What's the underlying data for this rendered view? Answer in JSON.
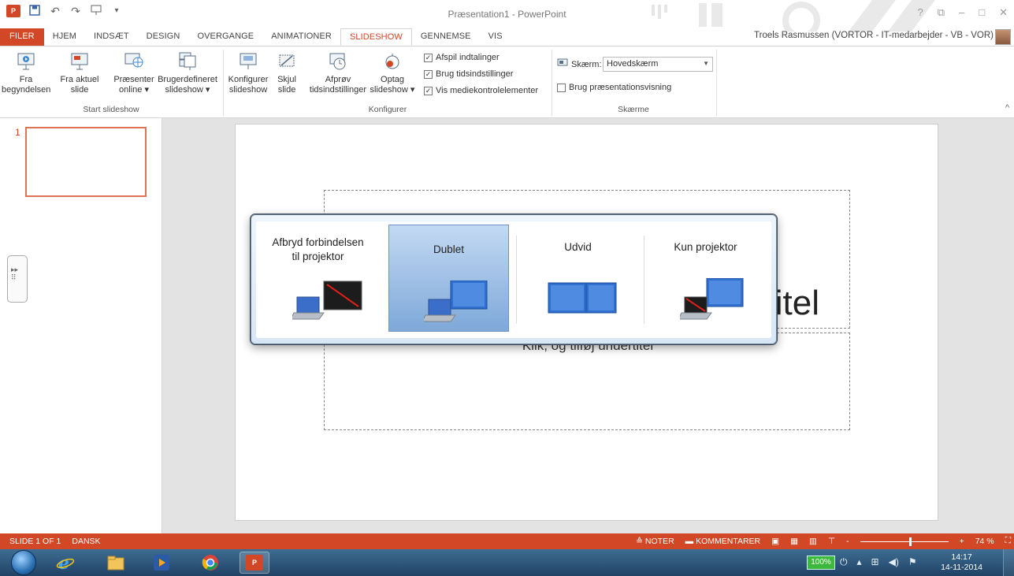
{
  "window": {
    "title": "Præsentation1 - PowerPoint",
    "app_badge": "P",
    "user": "Troels Rasmussen (VORTOR - IT-medarbejder - VB - VOR)",
    "help": "?",
    "restore_icon": "⧉",
    "minimize_icon": "–",
    "maximize_icon": "□",
    "close_icon": "✕"
  },
  "tabs": [
    {
      "label": "FILER"
    },
    {
      "label": "HJEM"
    },
    {
      "label": "INDSÆT"
    },
    {
      "label": "DESIGN"
    },
    {
      "label": "OVERGANGE"
    },
    {
      "label": "ANIMATIONER"
    },
    {
      "label": "SLIDESHOW"
    },
    {
      "label": "GENNEMSE"
    },
    {
      "label": "VIS"
    }
  ],
  "ribbon": {
    "start": {
      "label": "Start slideshow",
      "buttons": [
        {
          "line1": "Fra",
          "line2": "begyndelsen"
        },
        {
          "line1": "Fra aktuel",
          "line2": "slide"
        },
        {
          "line1": "Præsenter",
          "line2": "online ▾"
        },
        {
          "line1": "Brugerdefineret",
          "line2": "slideshow ▾"
        }
      ]
    },
    "configure": {
      "label": "Konfigurer",
      "buttons": [
        {
          "line1": "Konfigurer",
          "line2": "slideshow"
        },
        {
          "line1": "Skjul",
          "line2": "slide"
        },
        {
          "line1": "Afprøv",
          "line2": "tidsindstillinger"
        },
        {
          "line1": "Optag",
          "line2": "slideshow ▾"
        }
      ],
      "checkboxes": [
        {
          "label": "Afspil indtalinger",
          "checked": "✓"
        },
        {
          "label": "Brug tidsindstillinger",
          "checked": "✓"
        },
        {
          "label": "Vis mediekontrolelementer",
          "checked": "✓"
        }
      ]
    },
    "screens": {
      "label": "Skærme",
      "screen_label": "Skærm:",
      "screen_value": "Hovedskærm",
      "presenter_view_label": "Brug præsentationsvisning"
    },
    "collapse": "^"
  },
  "thumbnail_pane": {
    "slide_number": "1"
  },
  "slide": {
    "title_text": "itel",
    "subtitle_text": "Klik, og tilføj undertitel"
  },
  "project_panel": {
    "options": [
      {
        "label": "Afbryd forbindelsen til projektor",
        "icon": "laptop-disconnect-icon"
      },
      {
        "label": "Dublet",
        "icon": "laptop-duplicate-icon",
        "selected": true
      },
      {
        "label": "Udvid",
        "icon": "extend-screens-icon"
      },
      {
        "label": "Kun projektor",
        "icon": "projector-only-icon"
      }
    ]
  },
  "statusbar": {
    "slide_info": "SLIDE 1 OF 1",
    "language": "DANSK",
    "notes": "≙ NOTER",
    "comments": "KOMMENTARER",
    "zoom": "74 %",
    "zoom_minus": "-",
    "zoom_plus": "+"
  },
  "taskbar": {
    "battery": "100%",
    "time": "14:17",
    "date": "14-11-2014"
  },
  "colors": {
    "accent": "#d24726",
    "selected_option": "#7ea8d8",
    "taskbar": "#1f4264"
  }
}
